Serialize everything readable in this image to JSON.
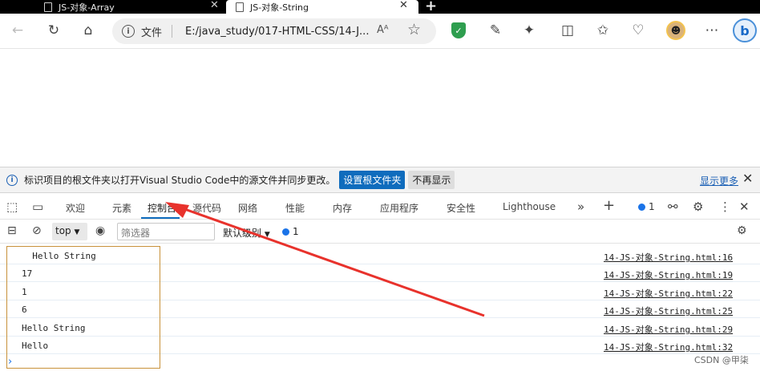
{
  "browser": {
    "tabs": [
      {
        "title": "JS-对象-Array",
        "active": false
      },
      {
        "title": "JS-对象-String",
        "active": true
      }
    ],
    "address": {
      "scheme_label": "文件",
      "url": "E:/java_study/017-HTML-CSS/14-J...",
      "read_aloud": "Aᴬ"
    },
    "icons": [
      "back-icon",
      "refresh-icon",
      "home-icon",
      "info-icon",
      "read-aloud-icon",
      "favorite-star-icon",
      "shield-icon",
      "eyedropper-icon",
      "extensions-icon",
      "split-screen-icon",
      "favorites-icon",
      "health-icon",
      "profile-avatar",
      "more-icon",
      "bing-icon"
    ]
  },
  "infobar": {
    "message": "标识项目的根文件夹以打开Visual Studio Code中的源文件并同步更改。",
    "primary_button": "设置根文件夹",
    "secondary_button": "不再显示",
    "more_link": "显示更多"
  },
  "devtools": {
    "tabs": [
      "欢迎",
      "元素",
      "控制台",
      "源代码",
      "网络",
      "性能",
      "内存",
      "应用程序",
      "安全性",
      "Lighthouse"
    ],
    "active_tab": "控制台",
    "issue_count": "1",
    "console_toolbar": {
      "context": "top",
      "filter_placeholder": "筛选器",
      "levels_label": "默认级别",
      "issues_count": "1"
    },
    "colors": {
      "accent": "#0f6cbd",
      "highlight_box": "#c8913a",
      "arrow": "#e8322c"
    }
  },
  "console": {
    "rows": [
      {
        "message": "  Hello String",
        "source": "14-JS-对象-String.html:16"
      },
      {
        "message": "17",
        "source": "14-JS-对象-String.html:19"
      },
      {
        "message": "1",
        "source": "14-JS-对象-String.html:22"
      },
      {
        "message": "6",
        "source": "14-JS-对象-String.html:25"
      },
      {
        "message": "Hello String",
        "source": "14-JS-对象-String.html:29"
      },
      {
        "message": "Hello",
        "source": "14-JS-对象-String.html:32"
      }
    ],
    "prompt": "›"
  },
  "watermark": "CSDN @甲柒"
}
